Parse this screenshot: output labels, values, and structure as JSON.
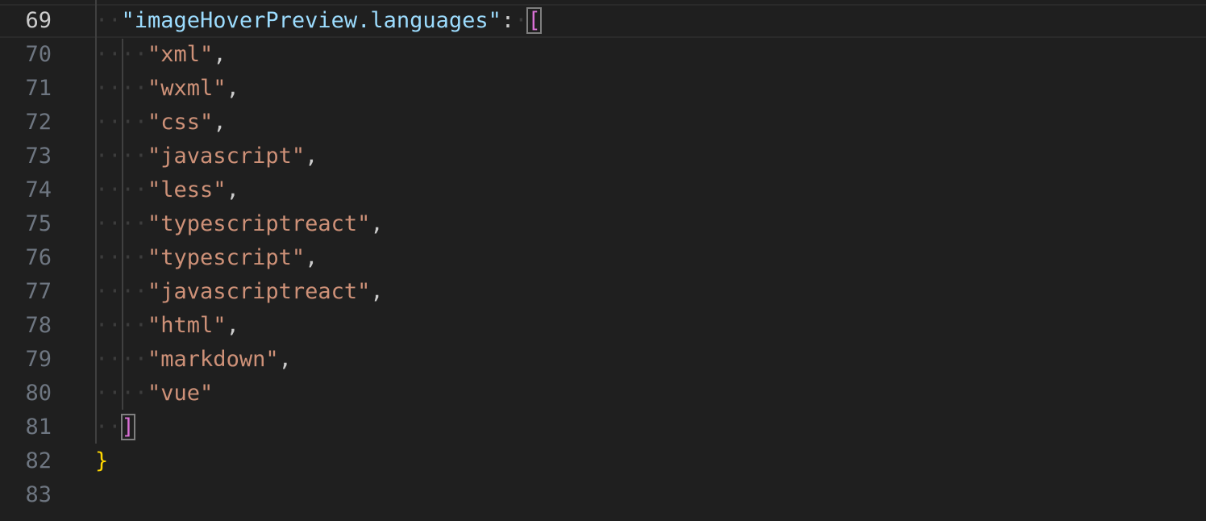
{
  "editor": {
    "current_line": 69,
    "lines": [
      {
        "num": "69",
        "indent": "··",
        "tokens": [
          {
            "t": "key",
            "v": "\"imageHoverPreview.languages\""
          },
          {
            "t": "punc",
            "v": ":"
          },
          {
            "t": "ws",
            "v": "·"
          },
          {
            "t": "bracket-open",
            "v": "["
          }
        ]
      },
      {
        "num": "70",
        "indent": "····",
        "tokens": [
          {
            "t": "str",
            "v": "\"xml\""
          },
          {
            "t": "punc",
            "v": ","
          }
        ]
      },
      {
        "num": "71",
        "indent": "····",
        "tokens": [
          {
            "t": "str",
            "v": "\"wxml\""
          },
          {
            "t": "punc",
            "v": ","
          }
        ]
      },
      {
        "num": "72",
        "indent": "····",
        "tokens": [
          {
            "t": "str",
            "v": "\"css\""
          },
          {
            "t": "punc",
            "v": ","
          }
        ]
      },
      {
        "num": "73",
        "indent": "····",
        "tokens": [
          {
            "t": "str",
            "v": "\"javascript\""
          },
          {
            "t": "punc",
            "v": ","
          }
        ]
      },
      {
        "num": "74",
        "indent": "····",
        "tokens": [
          {
            "t": "str",
            "v": "\"less\""
          },
          {
            "t": "punc",
            "v": ","
          }
        ]
      },
      {
        "num": "75",
        "indent": "····",
        "tokens": [
          {
            "t": "str",
            "v": "\"typescriptreact\""
          },
          {
            "t": "punc",
            "v": ","
          }
        ]
      },
      {
        "num": "76",
        "indent": "····",
        "tokens": [
          {
            "t": "str",
            "v": "\"typescript\""
          },
          {
            "t": "punc",
            "v": ","
          }
        ]
      },
      {
        "num": "77",
        "indent": "····",
        "tokens": [
          {
            "t": "str",
            "v": "\"javascriptreact\""
          },
          {
            "t": "punc",
            "v": ","
          }
        ]
      },
      {
        "num": "78",
        "indent": "····",
        "tokens": [
          {
            "t": "str",
            "v": "\"html\""
          },
          {
            "t": "punc",
            "v": ","
          }
        ]
      },
      {
        "num": "79",
        "indent": "····",
        "tokens": [
          {
            "t": "str",
            "v": "\"markdown\""
          },
          {
            "t": "punc",
            "v": ","
          }
        ]
      },
      {
        "num": "80",
        "indent": "····",
        "tokens": [
          {
            "t": "str",
            "v": "\"vue\""
          }
        ]
      },
      {
        "num": "81",
        "indent": "··",
        "tokens": [
          {
            "t": "bracket-close",
            "v": "]"
          }
        ]
      },
      {
        "num": "82",
        "indent": "",
        "tokens": [
          {
            "t": "brace",
            "v": "}"
          }
        ]
      },
      {
        "num": "83",
        "indent": "",
        "tokens": []
      }
    ]
  },
  "colors": {
    "background": "#1f1f1f",
    "line_number": "#6e7681",
    "line_number_active": "#cccccc",
    "key": "#9cdcfe",
    "string": "#ce9178",
    "punctuation": "#cccccc",
    "brace": "#ffd700",
    "bracket": "#da70d6",
    "whitespace_dot": "#3c3c3c"
  }
}
